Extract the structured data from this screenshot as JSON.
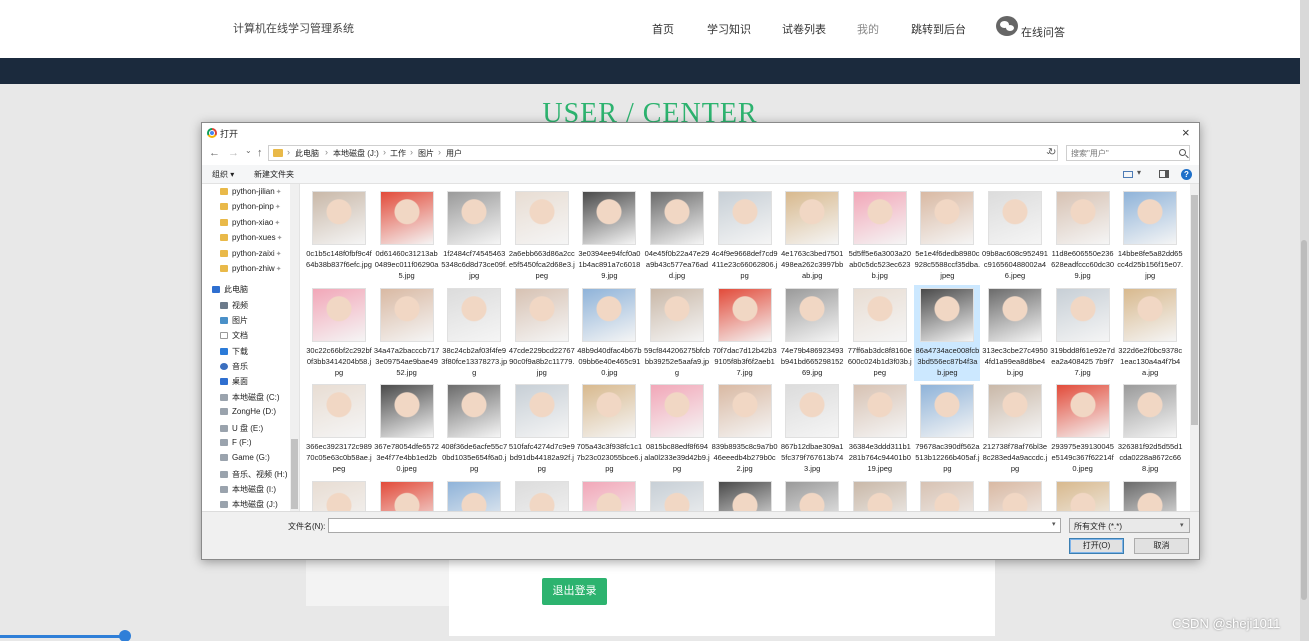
{
  "site": {
    "title": "计算机在线学习管理系统",
    "nav": [
      "首页",
      "学习知识",
      "试卷列表",
      "我的",
      "跳转到后台"
    ],
    "nav_online": "在线问答",
    "center_heading": "USER / CENTER",
    "logout_button": "退出登录",
    "watermark": "CSDN @sheji1011",
    "colors": {
      "accent": "#2db36f",
      "banner": "#1b2a3d"
    }
  },
  "dialog": {
    "title": "打开",
    "close": "×",
    "nav_back": "←",
    "nav_forward": "→",
    "nav_recent": "⌄",
    "nav_up": "↑",
    "breadcrumb": [
      "此电脑",
      "本地磁盘 (J:)",
      "工作",
      "图片",
      "用户"
    ],
    "breadcrumb_sep": "›",
    "refresh": "↻",
    "search_placeholder": "搜索\"用户\"",
    "toolbar": {
      "organize": "组织 ▾",
      "new_folder": "新建文件夹",
      "help": "?"
    },
    "sidebar": {
      "quick_access": [
        "python-jilian",
        "python-pinp",
        "python-xiao",
        "python-xues",
        "python-zaixi",
        "python-zhiw"
      ],
      "this_pc": "此电脑",
      "libraries": [
        {
          "label": "视频",
          "icon": "video-icon"
        },
        {
          "label": "图片",
          "icon": "picture-icon"
        },
        {
          "label": "文档",
          "icon": "document-icon"
        },
        {
          "label": "下载",
          "icon": "download-icon"
        },
        {
          "label": "音乐",
          "icon": "music-icon"
        },
        {
          "label": "桌面",
          "icon": "desktop-icon"
        }
      ],
      "drives": [
        "本地磁盘 (C:)",
        "ZongHe (D:)",
        "U 盘 (E:)",
        "F (F:)",
        "Game (G:)",
        "音乐、视频 (H:)",
        "本地磁盘 (I:)",
        "本地磁盘 (J:)"
      ]
    },
    "files": [
      "0c1b5c148f0fbf9c4f64b38b837f6efc.jpg",
      "0d61460c31213ab0489ec011f06290a5.jpg",
      "1f2484cf745454635348c6d8d73ce09f.jpg",
      "2a6ebb663d86a2cce5f5450fca2d68e3.jpeg",
      "3e0394ee94fcf0a01b4ac891a7c60189.jpg",
      "04e45f0b22a47e29a9b43c577ea76add.jpg",
      "4c4f9e9668def7cd9411e23c66062806.jpg",
      "4e1763c3bed7501498ea262c3997bbab.jpg",
      "5d5ff5e6a3003a20ab0c5dc523ec623b.jpg",
      "5e1e4f6dedb8980c928c5588ccf35dba.jpeg",
      "09b8ac608c952491c916560488002a46.jpeg",
      "11d8e606550e236628eadfccc60dc309.jpg",
      "14bbe8fe5a82dd65cc4d25b156f15e07.jpg",
      "30c22c66bf2c292bf0f3bb3414204b58.jpg",
      "34a47a2bacccb7173e09754ae9bae4952.jpg",
      "38c24cb2af03f4fe93f80fce13378273.jpg",
      "47cde229bcd2276790c0f9a8b2c11779.jpg",
      "48b9d40dfac4b67b09bb6e40e465c910.jpg",
      "59cf844206275bfcbbb39252e5aafa9.jpg",
      "70f7dac7d12b42b39105f8b3f6f2aeb17.jpg",
      "74e79b486923493b941bd66529815269.jpg",
      "77ff6ab3dc8f8160e600c024b1d3f03b.jpeg",
      "86a4734ace008fcb3bd556ec87b4f3ab.jpeg",
      "313ec3cbe27c49504fd1a99ea8d8be4b.jpg",
      "319bdd8f61e92e7dea2a408425 7b9f77.jpg",
      "322d6e2f0bc9378c1eac130a4a4f7b4a.jpg",
      "366ec3923172c98970c05e63c0b58ae.jpeg",
      "367e78054dfe65723e4f77e4bb1ed2b0.jpeg",
      "408f36de6acfe55c70bd1035e654f6a0.jpg",
      "510fafc4274d7c9e9bd91db44182a92f.jpg",
      "705a43c3f938fc1c17b23c023055bce6.jpg",
      "0815bc88edf8f694ala0l233e39d42b9.jpg",
      "839b8935c8c9a7b046eeedb4b279b0c2.jpg",
      "867b12dbae309a15fc379f767613b743.jpg",
      "36384e3ddd311b1281b764c94401b019.jpeg",
      "79678ac390df562a513b12266b405af.jpg",
      "212738f78af76bl3e8c283ed4a9accdc.jpg",
      "293975e39130045e5149c367f62214f0.jpeg",
      "326381f92d5d55d1cda0228a8672c668.jpg"
    ],
    "selected_index": 22,
    "filename_label": "文件名(N):",
    "filename_value": "",
    "filetype": "所有文件 (*.*)",
    "open_button": "打开(O)",
    "cancel_button": "取消"
  }
}
